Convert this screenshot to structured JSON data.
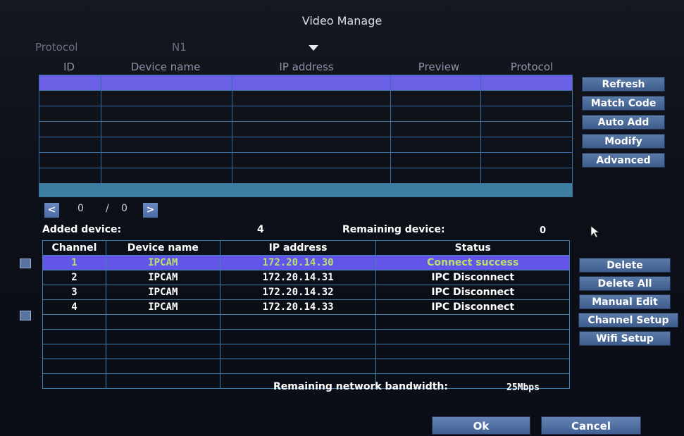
{
  "title": "Video Manage",
  "protocol": {
    "label": "Protocol",
    "value": "N1"
  },
  "top_table": {
    "headers": [
      "ID",
      "Device name",
      "IP address",
      "Preview",
      "Protocol"
    ]
  },
  "pager": {
    "prev": "<",
    "current": "0",
    "sep": "/",
    "total": "0",
    "next": ">"
  },
  "side_buttons_top": [
    "Refresh",
    "Match Code",
    "Auto Add",
    "Modify",
    "Advanced"
  ],
  "added": {
    "label": "Added device:",
    "count": "4",
    "remaining_label": "Remaining device:",
    "remaining_count": "0"
  },
  "device_table": {
    "headers": [
      "Channel",
      "Device name",
      "IP address",
      "Status"
    ],
    "rows": [
      {
        "channel": "1",
        "name": "IPCAM",
        "ip": "172.20.14.30",
        "status": "Connect success"
      },
      {
        "channel": "2",
        "name": "IPCAM",
        "ip": "172.20.14.31",
        "status": "IPC Disconnect"
      },
      {
        "channel": "3",
        "name": "IPCAM",
        "ip": "172.20.14.32",
        "status": "IPC Disconnect"
      },
      {
        "channel": "4",
        "name": "IPCAM",
        "ip": "172.20.14.33",
        "status": "IPC Disconnect"
      }
    ]
  },
  "side_buttons_bottom": [
    "Delete",
    "Delete All",
    "Manual Edit",
    "Channel Setup",
    "Wifi Setup"
  ],
  "bandwidth": {
    "label": "Remaining network bandwidth:",
    "value": "25Mbps"
  },
  "footer": {
    "ok": "Ok",
    "cancel": "Cancel"
  },
  "colors": {
    "selected_row": "#6455ea",
    "button": "#4c6aa3",
    "grid": "#3f80ae"
  }
}
